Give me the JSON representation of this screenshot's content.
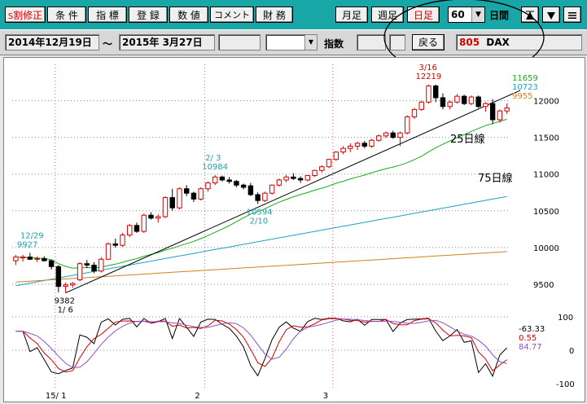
{
  "toolbar": {
    "buttons": [
      "割修正",
      "条 件",
      "指 標",
      "登 録",
      "数 値",
      "コメント",
      "財 務"
    ],
    "split_mark": "S",
    "period_buttons": [
      "月足",
      "週足",
      "日足"
    ],
    "count_value": "60",
    "range_label": "日間"
  },
  "info": {
    "date_from": "2014年12月19日",
    "tilde": "～",
    "date_to": "2015年 3月27日",
    "index_label": "指数",
    "back_button": "戻る",
    "code": "805",
    "name": "DAX"
  },
  "chart_data": {
    "type": "candlestick",
    "price_axis": {
      "ticks": [
        12000,
        11500,
        11000,
        10500,
        10000,
        9500
      ],
      "ylim": [
        9200,
        12450
      ]
    },
    "x_labels": [
      "15/ 1",
      "2",
      "3"
    ],
    "candles": [
      [
        9820,
        9900,
        9760,
        9870
      ],
      [
        9860,
        9900,
        9810,
        9870
      ],
      [
        9870,
        9927,
        9830,
        9840
      ],
      [
        9840,
        9880,
        9800,
        9850
      ],
      [
        9850,
        9880,
        9810,
        9820
      ],
      [
        9820,
        9840,
        9700,
        9740
      ],
      [
        9740,
        9760,
        9390,
        9470
      ],
      [
        9470,
        9520,
        9382,
        9490
      ],
      [
        9490,
        9530,
        9450,
        9510
      ],
      [
        9560,
        9800,
        9540,
        9780
      ],
      [
        9780,
        9830,
        9720,
        9760
      ],
      [
        9760,
        9800,
        9650,
        9680
      ],
      [
        9680,
        9870,
        9660,
        9840
      ],
      [
        9840,
        10070,
        9830,
        10050
      ],
      [
        10050,
        10120,
        10000,
        10030
      ],
      [
        10030,
        10200,
        10010,
        10170
      ],
      [
        10170,
        10320,
        10140,
        10300
      ],
      [
        10300,
        10340,
        10200,
        10220
      ],
      [
        10220,
        10460,
        10200,
        10440
      ],
      [
        10440,
        10480,
        10380,
        10400
      ],
      [
        10400,
        10450,
        10340,
        10420
      ],
      [
        10420,
        10700,
        10400,
        10680
      ],
      [
        10680,
        10800,
        10500,
        10540
      ],
      [
        10540,
        10820,
        10520,
        10800
      ],
      [
        10800,
        10850,
        10700,
        10740
      ],
      [
        10740,
        10760,
        10620,
        10660
      ],
      [
        10660,
        10820,
        10640,
        10800
      ],
      [
        10800,
        10900,
        10760,
        10880
      ],
      [
        10880,
        10984,
        10850,
        10960
      ],
      [
        10960,
        10980,
        10900,
        10920
      ],
      [
        10920,
        10960,
        10870,
        10900
      ],
      [
        10900,
        10920,
        10820,
        10850
      ],
      [
        10850,
        10870,
        10790,
        10820
      ],
      [
        10840,
        10880,
        10700,
        10720
      ],
      [
        10720,
        10750,
        10594,
        10640
      ],
      [
        10640,
        10760,
        10620,
        10740
      ],
      [
        10740,
        10860,
        10720,
        10850
      ],
      [
        10850,
        10940,
        10830,
        10920
      ],
      [
        10920,
        10990,
        10890,
        10960
      ],
      [
        10960,
        11010,
        10920,
        10940
      ],
      [
        10940,
        10970,
        10880,
        10920
      ],
      [
        10920,
        10990,
        10900,
        10980
      ],
      [
        10980,
        11060,
        10960,
        11050
      ],
      [
        11050,
        11120,
        11020,
        11100
      ],
      [
        11100,
        11210,
        11080,
        11200
      ],
      [
        11200,
        11310,
        11180,
        11300
      ],
      [
        11300,
        11380,
        11270,
        11350
      ],
      [
        11350,
        11420,
        11300,
        11380
      ],
      [
        11380,
        11440,
        11330,
        11420
      ],
      [
        11420,
        11450,
        11350,
        11380
      ],
      [
        11380,
        11480,
        11360,
        11460
      ],
      [
        11460,
        11540,
        11440,
        11520
      ],
      [
        11520,
        11580,
        11490,
        11560
      ],
      [
        11560,
        11590,
        11480,
        11500
      ],
      [
        11500,
        11580,
        11380,
        11560
      ],
      [
        11560,
        11800,
        11540,
        11780
      ],
      [
        11780,
        11900,
        11750,
        11880
      ],
      [
        11880,
        12000,
        11860,
        11980
      ],
      [
        11980,
        12219,
        11960,
        12200
      ],
      [
        12200,
        12219,
        11980,
        12040
      ],
      [
        12040,
        12100,
        11880,
        11920
      ],
      [
        11920,
        12000,
        11880,
        11980
      ],
      [
        11980,
        12090,
        11960,
        12060
      ],
      [
        12060,
        12080,
        11940,
        11960
      ],
      [
        11960,
        12070,
        11940,
        12050
      ],
      [
        12050,
        12070,
        11900,
        11920
      ],
      [
        11920,
        11980,
        11850,
        11960
      ],
      [
        11960,
        12020,
        11680,
        11740
      ],
      [
        11740,
        11880,
        11700,
        11860
      ],
      [
        11860,
        11960,
        11820,
        11900
      ]
    ],
    "ma25_label": "25日線",
    "ma75_label": "75日線",
    "price_legend": [
      {
        "value": "11659",
        "color": "#1aaa1a"
      },
      {
        "value": "10723",
        "color": "#20a0c8"
      },
      {
        "value": "9955",
        "color": "#d08020"
      }
    ],
    "annotations": [
      {
        "text1": "12/29",
        "text2": "9927",
        "color": "#20a0b0",
        "index": 2,
        "price": 9927,
        "position": "above"
      },
      {
        "text1": "9382",
        "text2": "1/ 6",
        "color": "#000000",
        "index": 7,
        "price": 9382,
        "position": "below"
      },
      {
        "text1": "2/ 3",
        "text2": "10984",
        "color": "#20a0b0",
        "index": 28,
        "price": 10984,
        "position": "above"
      },
      {
        "text1": "10594",
        "text2": "2/10",
        "color": "#20a0b0",
        "index": 34,
        "price": 10594,
        "position": "below"
      },
      {
        "text1": "3/16",
        "text2": "12219",
        "color": "#d40000",
        "index": 58,
        "price": 12219,
        "position": "above"
      }
    ],
    "oscillator": {
      "ticks": [
        "100",
        "0",
        "-100"
      ],
      "values": [
        {
          "value": "-63.33",
          "color": "#000000"
        },
        {
          "value": "0.55",
          "color": "#d40000"
        },
        {
          "value": "84.77",
          "color": "#9050c0"
        }
      ]
    }
  }
}
